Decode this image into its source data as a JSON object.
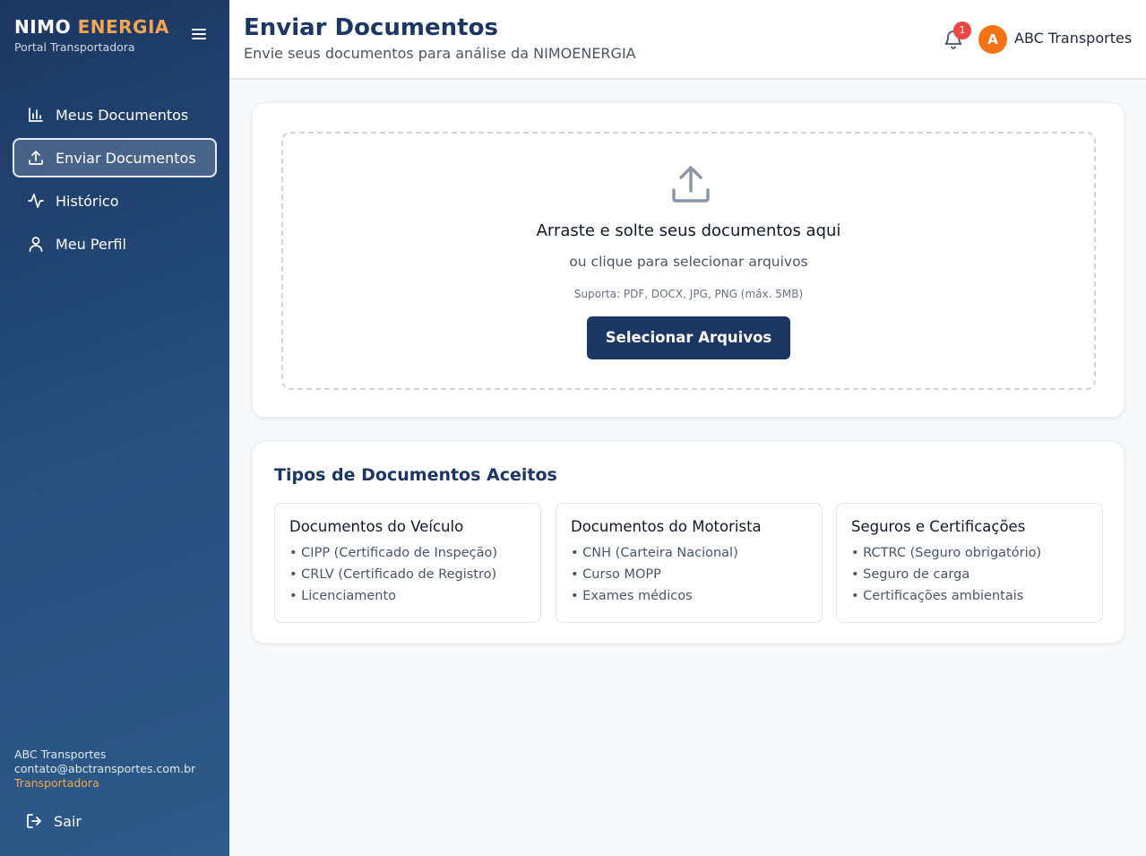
{
  "sidebar": {
    "brand_part1": "NIMO",
    "brand_part2": "ENERGIA",
    "brand_subtitle": "Portal Transportadora",
    "nav": [
      {
        "label": "Meus Documentos",
        "icon": "bar-chart-icon",
        "active": false
      },
      {
        "label": "Enviar Documentos",
        "icon": "upload-icon",
        "active": true
      },
      {
        "label": "Histórico",
        "icon": "activity-icon",
        "active": false
      },
      {
        "label": "Meu Perfil",
        "icon": "user-icon",
        "active": false
      }
    ],
    "user_name": "ABC Transportes",
    "user_email": "contato@abctransportes.com.br",
    "user_role": "Transportadora",
    "logout_label": "Sair"
  },
  "header": {
    "title": "Enviar Documentos",
    "subtitle": "Envie seus documentos para análise da NIMOENERGIA",
    "notification_count": "1",
    "avatar_initial": "A",
    "company_name": "ABC Transportes"
  },
  "upload": {
    "title": "Arraste e solte seus documentos aqui",
    "subtitle": "ou clique para selecionar arquivos",
    "hint": "Suporta: PDF, DOCX, JPG, PNG (máx. 5MB)",
    "button_label": "Selecionar Arquivos"
  },
  "doc_types": {
    "title": "Tipos de Documentos Aceitos",
    "groups": [
      {
        "title": "Documentos do Veículo",
        "items": [
          "CIPP (Certificado de Inspeção)",
          "CRLV (Certificado de Registro)",
          "Licenciamento"
        ]
      },
      {
        "title": "Documentos do Motorista",
        "items": [
          "CNH (Carteira Nacional)",
          "Curso MOPP",
          "Exames médicos"
        ]
      },
      {
        "title": "Seguros e Certificações",
        "items": [
          "RCTRC (Seguro obrigatório)",
          "Seguro de carga",
          "Certificações ambientais"
        ]
      }
    ]
  },
  "colors": {
    "primary": "#1c3763",
    "accent": "#f4a550",
    "badge": "#ef4444",
    "avatar": "#f97316"
  }
}
